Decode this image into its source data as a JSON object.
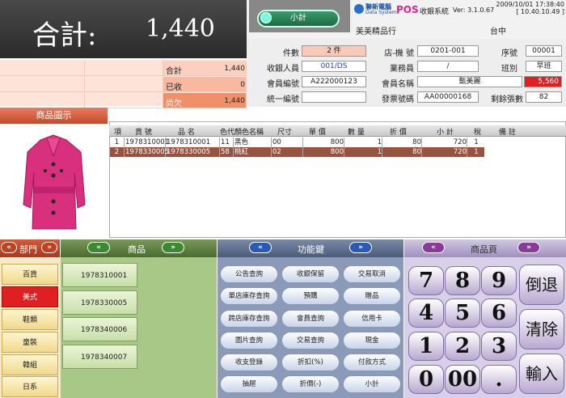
{
  "total": {
    "label": "合計:",
    "value": "1,440"
  },
  "header": {
    "subtotal_label": "小計",
    "brand": "聯新電腦",
    "brand_sub": "Data Systems",
    "pos_title": "POS",
    "pos_sub": "收銀系統",
    "version": "Ver: 3.1.0.67",
    "datetime": "2009/10/01 17:38:40",
    "ip": "[ 10.40.10.49 ]",
    "store": "美美精品行",
    "branch": "台中"
  },
  "info": {
    "count_label": "件數",
    "count_value": "2 件",
    "store_no_label": "店-機 號",
    "store_no_value": "0201-001",
    "seq_label": "序號",
    "seq_value": "00001",
    "cashier_label": "收銀人員",
    "cashier_value": "001/DS",
    "sales_label": "業務員",
    "sales_value": "/",
    "shift_label": "班別",
    "shift_value": "早班",
    "member_no_label": "會員編號",
    "member_no_value": "A222000123",
    "member_name_label": "會員名稱",
    "member_name_value": "甄美麗",
    "member_points": "5,560",
    "tax_id_label": "統一編號",
    "tax_id_value": "",
    "invoice_label": "發票號碼",
    "invoice_value": "AA00000168",
    "remaining_label": "剩餘張數",
    "remaining_value": "82"
  },
  "summary": {
    "rows": [
      {
        "label": "合計",
        "value": "1,440"
      },
      {
        "label": "已收",
        "value": "0"
      },
      {
        "label": "尚欠",
        "value": "1,440"
      }
    ]
  },
  "image_panel": {
    "title": "商品圖示"
  },
  "table": {
    "headers": [
      "項",
      "貨 號",
      "品 名",
      "色代",
      "顏色名稱",
      "尺寸",
      "單 價",
      "數 量",
      "折 價",
      "小 計",
      "稅",
      "備 註"
    ],
    "rows": [
      [
        "1",
        "1978310001",
        "1978310001",
        "11",
        "黑色",
        "00",
        "800",
        "1",
        "80",
        "720",
        "1",
        ""
      ],
      [
        "2",
        "1978330005",
        "1978330005",
        "58",
        "桃紅",
        "02",
        "800",
        "1",
        "80",
        "720",
        "1",
        ""
      ]
    ]
  },
  "bottom": {
    "dept_title": "部門",
    "product_title": "商品",
    "func_title": "功能鍵",
    "page_title": "商品頁",
    "left_arrow": "«",
    "right_arrow": "»",
    "depts": [
      "百貨",
      "美式",
      "鞋類",
      "童裝",
      "韓組",
      "日系"
    ],
    "products": [
      "1978310001",
      "1978330005",
      "1978340006",
      "1978340007"
    ],
    "functions": [
      "公告查詢",
      "收銀保留",
      "交易取消",
      "單店庫存查詢",
      "預購",
      "贈品",
      "跨店庫存查詢",
      "會員查詢",
      "信用卡",
      "圖片查詢",
      "交易查詢",
      "現金",
      "收支登錄",
      "折扣(%)",
      "付款方式",
      "抽屜",
      "折價(-)",
      "小計"
    ],
    "keys": [
      "7",
      "8",
      "9",
      "4",
      "5",
      "6",
      "1",
      "2",
      "3",
      "0",
      "00",
      "."
    ],
    "big_keys": [
      "倒退",
      "清除",
      "輸入"
    ]
  }
}
